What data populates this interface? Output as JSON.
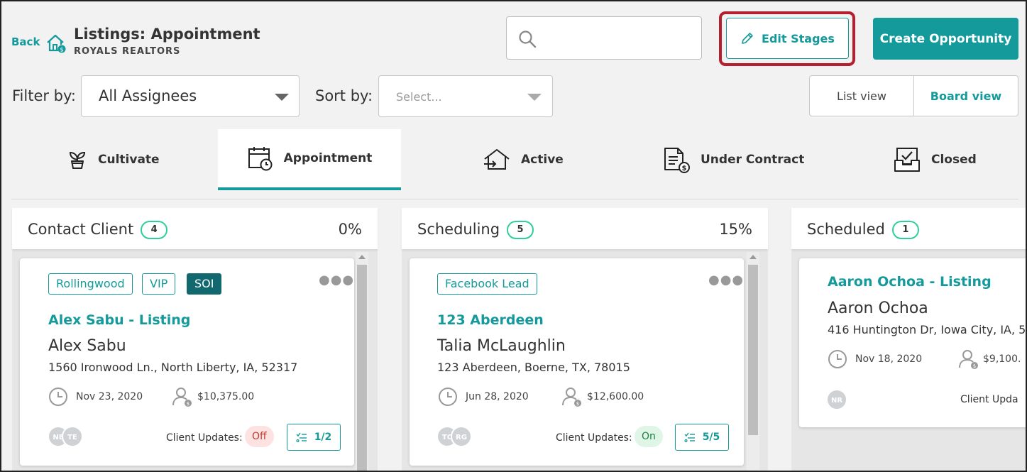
{
  "header": {
    "back_label": "Back",
    "title": "Listings: Appointment",
    "subtitle": "ROYALS REALTORS",
    "search_placeholder": "",
    "edit_stages_label": "Edit Stages",
    "create_label": "Create Opportunity"
  },
  "filters": {
    "filter_label": "Filter by:",
    "filter_value": "All Assignees",
    "sort_label": "Sort by:",
    "sort_placeholder": "Select...",
    "list_view_label": "List view",
    "board_view_label": "Board view"
  },
  "stages": [
    {
      "label": "Cultivate",
      "icon": "sprout-icon"
    },
    {
      "label": "Appointment",
      "icon": "calendar-clock-icon",
      "active": true
    },
    {
      "label": "Active",
      "icon": "house-arrow-icon"
    },
    {
      "label": "Under Contract",
      "icon": "contract-dollar-icon"
    },
    {
      "label": "Closed",
      "icon": "inbox-check-icon"
    }
  ],
  "columns": [
    {
      "name": "Contact Client",
      "count": "4",
      "percent": "0%",
      "card": {
        "tags": [
          "Rollingwood",
          "VIP",
          "SOI"
        ],
        "listing": "Alex Sabu - Listing",
        "person": "Alex Sabu",
        "address": "1560 Ironwood Ln., North Liberty, IA, 52317",
        "date": "Nov 23, 2020",
        "amount": "$10,375.00",
        "avatars": [
          "NE",
          "TE"
        ],
        "client_updates_label": "Client Updates:",
        "client_updates": "Off",
        "tasks": "1/2"
      }
    },
    {
      "name": "Scheduling",
      "count": "5",
      "percent": "15%",
      "card": {
        "tags": [
          "Facebook Lead"
        ],
        "listing": "123 Aberdeen",
        "person": "Talia McLaughlin",
        "address": "123 Aberdeen, Boerne, TX, 78015",
        "date": "Jun 28, 2020",
        "amount": "$12,600.00",
        "avatars": [
          "TC",
          "RG"
        ],
        "client_updates_label": "Client Updates:",
        "client_updates": "On",
        "tasks": "5/5"
      }
    },
    {
      "name": "Scheduled",
      "count": "1",
      "percent": "",
      "card": {
        "tags": [],
        "listing": "Aaron Ochoa - Listing",
        "person": "Aaron Ochoa",
        "address": "416 Huntington Dr, Iowa City, IA, 5",
        "date": "Nov 18, 2020",
        "amount": "$9,100.",
        "avatars": [
          "NR"
        ],
        "client_updates_label": "Client Upda",
        "client_updates": "",
        "tasks": ""
      }
    }
  ],
  "colors": {
    "accent": "#149a9b",
    "highlight": "#b51f2e",
    "count_border": "#2fcf9c"
  }
}
